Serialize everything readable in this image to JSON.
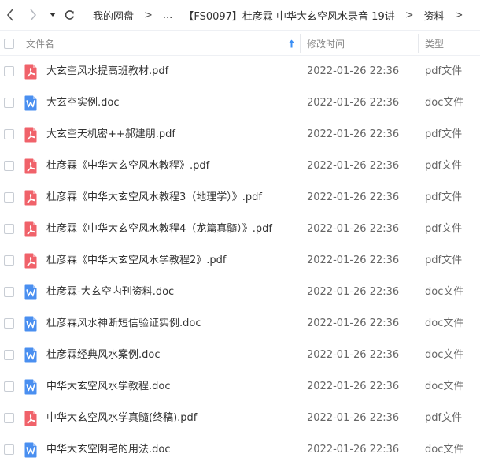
{
  "breadcrumb": {
    "items": [
      "我的网盘",
      "...",
      "【FS0097】杜彦霖 中华大玄空风水录音 19讲",
      "资料"
    ],
    "separator": ">"
  },
  "header": {
    "name_label": "文件名",
    "time_label": "修改时间",
    "type_label": "类型"
  },
  "colors": {
    "pdf": "#f0626a",
    "doc": "#4a8ff0",
    "sort_arrow": "#3b8ff5"
  },
  "files": [
    {
      "name": "大玄空风水提高班教材.pdf",
      "time": "2022-01-26 22:36",
      "type": "pdf文件",
      "icon": "pdf-icon"
    },
    {
      "name": "大玄空实例.doc",
      "time": "2022-01-26 22:36",
      "type": "doc文件",
      "icon": "word-icon"
    },
    {
      "name": "大玄空天机密++郝建朋.pdf",
      "time": "2022-01-26 22:36",
      "type": "pdf文件",
      "icon": "pdf-icon"
    },
    {
      "name": "杜彦霖《中华大玄空风水教程》.pdf",
      "time": "2022-01-26 22:36",
      "type": "pdf文件",
      "icon": "pdf-icon"
    },
    {
      "name": "杜彦霖《中华大玄空风水教程3（地理学）》.pdf",
      "time": "2022-01-26 22:36",
      "type": "pdf文件",
      "icon": "pdf-icon"
    },
    {
      "name": "杜彦霖《中华大玄空风水教程4（龙篇真髓）》.pdf",
      "time": "2022-01-26 22:36",
      "type": "pdf文件",
      "icon": "pdf-icon"
    },
    {
      "name": "杜彦霖《中华大玄空风水学教程2》.pdf",
      "time": "2022-01-26 22:36",
      "type": "pdf文件",
      "icon": "pdf-icon"
    },
    {
      "name": "杜彦霖-大玄空内刊资料.doc",
      "time": "2022-01-26 22:36",
      "type": "doc文件",
      "icon": "word-icon"
    },
    {
      "name": "杜彦霖风水神断短信验证实例.doc",
      "time": "2022-01-26 22:36",
      "type": "doc文件",
      "icon": "word-icon"
    },
    {
      "name": "杜彦霖经典风水案例.doc",
      "time": "2022-01-26 22:36",
      "type": "doc文件",
      "icon": "word-icon"
    },
    {
      "name": "中华大玄空风水学教程.doc",
      "time": "2022-01-26 22:36",
      "type": "doc文件",
      "icon": "word-icon"
    },
    {
      "name": "中华大玄空风水学真髓(终稿).pdf",
      "time": "2022-01-26 22:36",
      "type": "pdf文件",
      "icon": "pdf-icon"
    },
    {
      "name": "中华大玄空阴宅的用法.doc",
      "time": "2022-01-26 22:36",
      "type": "doc文件",
      "icon": "word-icon"
    }
  ]
}
